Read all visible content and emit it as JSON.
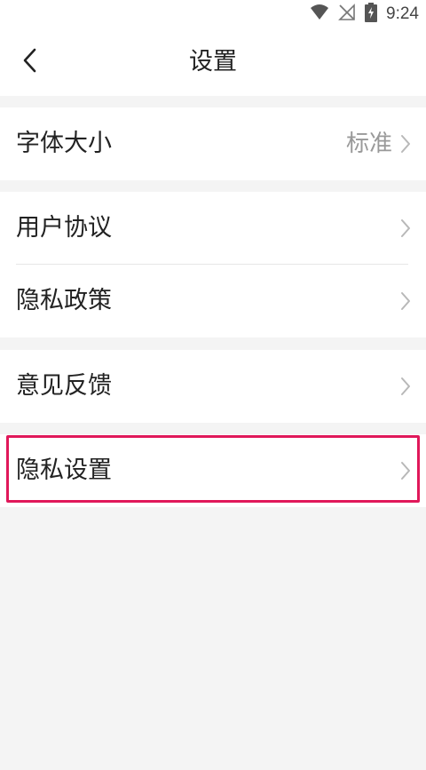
{
  "status_bar": {
    "time": "9:24",
    "icons": [
      "wifi-icon",
      "no-signal-icon",
      "battery-charging-icon"
    ]
  },
  "header": {
    "title": "设置",
    "back_icon": "chevron-left-icon"
  },
  "groups": [
    {
      "items": [
        {
          "label": "字体大小",
          "value": "标准"
        }
      ]
    },
    {
      "items": [
        {
          "label": "用户协议"
        },
        {
          "label": "隐私政策"
        }
      ]
    },
    {
      "items": [
        {
          "label": "意见反馈"
        }
      ]
    },
    {
      "items": [
        {
          "label": "隐私设置"
        }
      ]
    }
  ],
  "colors": {
    "background": "#f4f4f4",
    "card": "#ffffff",
    "highlight_border": "#e0185a",
    "muted_text": "#999999"
  }
}
